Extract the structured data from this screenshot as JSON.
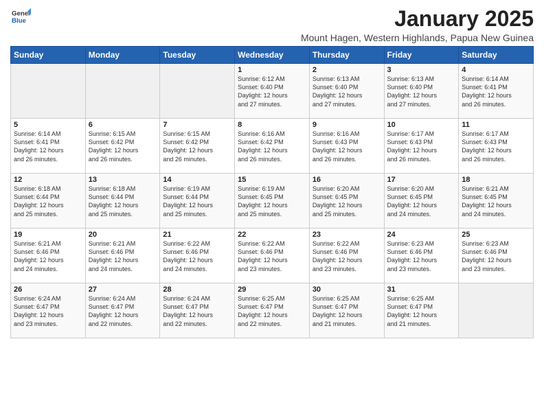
{
  "logo": {
    "general": "General",
    "blue": "Blue"
  },
  "title": "January 2025",
  "subtitle": "Mount Hagen, Western Highlands, Papua New Guinea",
  "days_header": [
    "Sunday",
    "Monday",
    "Tuesday",
    "Wednesday",
    "Thursday",
    "Friday",
    "Saturday"
  ],
  "weeks": [
    [
      {
        "num": "",
        "info": ""
      },
      {
        "num": "",
        "info": ""
      },
      {
        "num": "",
        "info": ""
      },
      {
        "num": "1",
        "info": "Sunrise: 6:12 AM\nSunset: 6:40 PM\nDaylight: 12 hours\nand 27 minutes."
      },
      {
        "num": "2",
        "info": "Sunrise: 6:13 AM\nSunset: 6:40 PM\nDaylight: 12 hours\nand 27 minutes."
      },
      {
        "num": "3",
        "info": "Sunrise: 6:13 AM\nSunset: 6:40 PM\nDaylight: 12 hours\nand 27 minutes."
      },
      {
        "num": "4",
        "info": "Sunrise: 6:14 AM\nSunset: 6:41 PM\nDaylight: 12 hours\nand 26 minutes."
      }
    ],
    [
      {
        "num": "5",
        "info": "Sunrise: 6:14 AM\nSunset: 6:41 PM\nDaylight: 12 hours\nand 26 minutes."
      },
      {
        "num": "6",
        "info": "Sunrise: 6:15 AM\nSunset: 6:42 PM\nDaylight: 12 hours\nand 26 minutes."
      },
      {
        "num": "7",
        "info": "Sunrise: 6:15 AM\nSunset: 6:42 PM\nDaylight: 12 hours\nand 26 minutes."
      },
      {
        "num": "8",
        "info": "Sunrise: 6:16 AM\nSunset: 6:42 PM\nDaylight: 12 hours\nand 26 minutes."
      },
      {
        "num": "9",
        "info": "Sunrise: 6:16 AM\nSunset: 6:43 PM\nDaylight: 12 hours\nand 26 minutes."
      },
      {
        "num": "10",
        "info": "Sunrise: 6:17 AM\nSunset: 6:43 PM\nDaylight: 12 hours\nand 26 minutes."
      },
      {
        "num": "11",
        "info": "Sunrise: 6:17 AM\nSunset: 6:43 PM\nDaylight: 12 hours\nand 26 minutes."
      }
    ],
    [
      {
        "num": "12",
        "info": "Sunrise: 6:18 AM\nSunset: 6:44 PM\nDaylight: 12 hours\nand 25 minutes."
      },
      {
        "num": "13",
        "info": "Sunrise: 6:18 AM\nSunset: 6:44 PM\nDaylight: 12 hours\nand 25 minutes."
      },
      {
        "num": "14",
        "info": "Sunrise: 6:19 AM\nSunset: 6:44 PM\nDaylight: 12 hours\nand 25 minutes."
      },
      {
        "num": "15",
        "info": "Sunrise: 6:19 AM\nSunset: 6:45 PM\nDaylight: 12 hours\nand 25 minutes."
      },
      {
        "num": "16",
        "info": "Sunrise: 6:20 AM\nSunset: 6:45 PM\nDaylight: 12 hours\nand 25 minutes."
      },
      {
        "num": "17",
        "info": "Sunrise: 6:20 AM\nSunset: 6:45 PM\nDaylight: 12 hours\nand 24 minutes."
      },
      {
        "num": "18",
        "info": "Sunrise: 6:21 AM\nSunset: 6:45 PM\nDaylight: 12 hours\nand 24 minutes."
      }
    ],
    [
      {
        "num": "19",
        "info": "Sunrise: 6:21 AM\nSunset: 6:46 PM\nDaylight: 12 hours\nand 24 minutes."
      },
      {
        "num": "20",
        "info": "Sunrise: 6:21 AM\nSunset: 6:46 PM\nDaylight: 12 hours\nand 24 minutes."
      },
      {
        "num": "21",
        "info": "Sunrise: 6:22 AM\nSunset: 6:46 PM\nDaylight: 12 hours\nand 24 minutes."
      },
      {
        "num": "22",
        "info": "Sunrise: 6:22 AM\nSunset: 6:46 PM\nDaylight: 12 hours\nand 23 minutes."
      },
      {
        "num": "23",
        "info": "Sunrise: 6:22 AM\nSunset: 6:46 PM\nDaylight: 12 hours\nand 23 minutes."
      },
      {
        "num": "24",
        "info": "Sunrise: 6:23 AM\nSunset: 6:46 PM\nDaylight: 12 hours\nand 23 minutes."
      },
      {
        "num": "25",
        "info": "Sunrise: 6:23 AM\nSunset: 6:46 PM\nDaylight: 12 hours\nand 23 minutes."
      }
    ],
    [
      {
        "num": "26",
        "info": "Sunrise: 6:24 AM\nSunset: 6:47 PM\nDaylight: 12 hours\nand 23 minutes."
      },
      {
        "num": "27",
        "info": "Sunrise: 6:24 AM\nSunset: 6:47 PM\nDaylight: 12 hours\nand 22 minutes."
      },
      {
        "num": "28",
        "info": "Sunrise: 6:24 AM\nSunset: 6:47 PM\nDaylight: 12 hours\nand 22 minutes."
      },
      {
        "num": "29",
        "info": "Sunrise: 6:25 AM\nSunset: 6:47 PM\nDaylight: 12 hours\nand 22 minutes."
      },
      {
        "num": "30",
        "info": "Sunrise: 6:25 AM\nSunset: 6:47 PM\nDaylight: 12 hours\nand 21 minutes."
      },
      {
        "num": "31",
        "info": "Sunrise: 6:25 AM\nSunset: 6:47 PM\nDaylight: 12 hours\nand 21 minutes."
      },
      {
        "num": "",
        "info": ""
      }
    ]
  ]
}
